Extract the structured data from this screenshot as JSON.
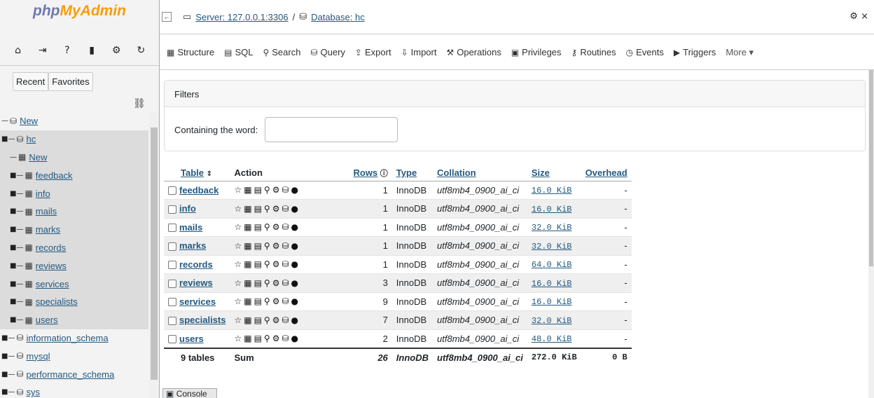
{
  "logo": {
    "part1": "php",
    "part2": "MyAdmin"
  },
  "nav_icons": [
    "home-icon",
    "logout-icon",
    "help-icon",
    "docs-icon",
    "settings-icon",
    "reload-icon"
  ],
  "nav_icon_glyphs": [
    "⌂",
    "⇥",
    "?",
    "▮",
    "⚙",
    "↻"
  ],
  "sidebar": {
    "recent_label": "Recent",
    "favorites_label": "Favorites",
    "tree": [
      {
        "label": "New",
        "level": 0,
        "icon": "new-db-icon"
      },
      {
        "label": "hc",
        "level": 0,
        "icon": "database-icon",
        "expanded": true
      },
      {
        "label": "New",
        "level": 1,
        "icon": "new-table-icon"
      },
      {
        "label": "feedback",
        "level": 1,
        "icon": "table-icon"
      },
      {
        "label": "info",
        "level": 1,
        "icon": "table-icon"
      },
      {
        "label": "mails",
        "level": 1,
        "icon": "table-icon"
      },
      {
        "label": "marks",
        "level": 1,
        "icon": "table-icon"
      },
      {
        "label": "records",
        "level": 1,
        "icon": "table-icon"
      },
      {
        "label": "reviews",
        "level": 1,
        "icon": "table-icon"
      },
      {
        "label": "services",
        "level": 1,
        "icon": "table-icon"
      },
      {
        "label": "specialists",
        "level": 1,
        "icon": "table-icon"
      },
      {
        "label": "users",
        "level": 1,
        "icon": "table-icon"
      },
      {
        "label": "information_schema",
        "level": 0,
        "icon": "database-icon"
      },
      {
        "label": "mysql",
        "level": 0,
        "icon": "database-icon"
      },
      {
        "label": "performance_schema",
        "level": 0,
        "icon": "database-icon"
      },
      {
        "label": "sys",
        "level": 0,
        "icon": "database-icon"
      }
    ]
  },
  "breadcrumb": {
    "server": "Server: 127.0.0.1:3306",
    "separator": "/",
    "database": "Database: hc"
  },
  "tabs": [
    {
      "label": "Structure",
      "icon": "structure-icon",
      "glyph": "▦"
    },
    {
      "label": "SQL",
      "icon": "sql-icon",
      "glyph": "▤"
    },
    {
      "label": "Search",
      "icon": "search-icon",
      "glyph": "⚲"
    },
    {
      "label": "Query",
      "icon": "query-icon",
      "glyph": "⛁"
    },
    {
      "label": "Export",
      "icon": "export-icon",
      "glyph": "⇪"
    },
    {
      "label": "Import",
      "icon": "import-icon",
      "glyph": "⇩"
    },
    {
      "label": "Operations",
      "icon": "operations-icon",
      "glyph": "⚒"
    },
    {
      "label": "Privileges",
      "icon": "privileges-icon",
      "glyph": "▣"
    },
    {
      "label": "Routines",
      "icon": "routines-icon",
      "glyph": "⚷"
    },
    {
      "label": "Events",
      "icon": "events-icon",
      "glyph": "◷"
    },
    {
      "label": "Triggers",
      "icon": "triggers-icon",
      "glyph": "▶"
    },
    {
      "label": "More ▾",
      "icon": "more-icon",
      "glyph": ""
    }
  ],
  "filters": {
    "title": "Filters",
    "label": "Containing the word:",
    "value": ""
  },
  "table": {
    "headers": {
      "table": "Table",
      "action": "Action",
      "rows": "Rows",
      "type": "Type",
      "collation": "Collation",
      "size": "Size",
      "overhead": "Overhead"
    },
    "sort_icon": "⇕",
    "help_icon": "ⓘ",
    "action_glyphs": "☆▦▤⚲⚙⛁●",
    "rows": [
      {
        "name": "feedback",
        "rows": "1",
        "type": "InnoDB",
        "collation": "utf8mb4_0900_ai_ci",
        "size": "16.0 KiB",
        "overhead": "-"
      },
      {
        "name": "info",
        "rows": "1",
        "type": "InnoDB",
        "collation": "utf8mb4_0900_ai_ci",
        "size": "16.0 KiB",
        "overhead": "-"
      },
      {
        "name": "mails",
        "rows": "1",
        "type": "InnoDB",
        "collation": "utf8mb4_0900_ai_ci",
        "size": "32.0 KiB",
        "overhead": "-"
      },
      {
        "name": "marks",
        "rows": "1",
        "type": "InnoDB",
        "collation": "utf8mb4_0900_ai_ci",
        "size": "32.0 KiB",
        "overhead": "-"
      },
      {
        "name": "records",
        "rows": "1",
        "type": "InnoDB",
        "collation": "utf8mb4_0900_ai_ci",
        "size": "64.0 KiB",
        "overhead": "-"
      },
      {
        "name": "reviews",
        "rows": "3",
        "type": "InnoDB",
        "collation": "utf8mb4_0900_ai_ci",
        "size": "16.0 KiB",
        "overhead": "-"
      },
      {
        "name": "services",
        "rows": "9",
        "type": "InnoDB",
        "collation": "utf8mb4_0900_ai_ci",
        "size": "16.0 KiB",
        "overhead": "-"
      },
      {
        "name": "specialists",
        "rows": "7",
        "type": "InnoDB",
        "collation": "utf8mb4_0900_ai_ci",
        "size": "32.0 KiB",
        "overhead": "-"
      },
      {
        "name": "users",
        "rows": "2",
        "type": "InnoDB",
        "collation": "utf8mb4_0900_ai_ci",
        "size": "48.0 KiB",
        "overhead": "-"
      }
    ],
    "sum": {
      "count": "9 tables",
      "label": "Sum",
      "rows": "26",
      "type": "InnoDB",
      "collation": "utf8mb4_0900_ai_ci",
      "size": "272.0 KiB",
      "overhead": "0 B"
    }
  },
  "console_label": "Console",
  "console_glyph": "▣"
}
